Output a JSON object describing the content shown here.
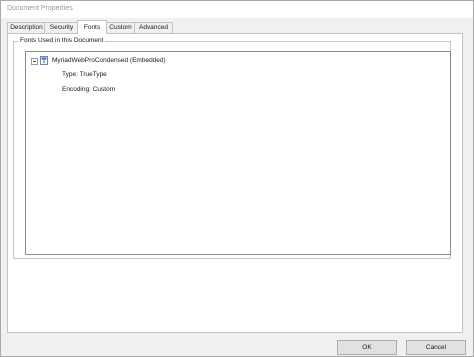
{
  "window": {
    "title": "Document Properties"
  },
  "tabs": [
    {
      "label": "Description"
    },
    {
      "label": "Security"
    },
    {
      "label": "Fonts",
      "active": true
    },
    {
      "label": "Custom"
    },
    {
      "label": "Advanced"
    }
  ],
  "fonts_group": {
    "label": "Fonts Used in this Document"
  },
  "font_tree": {
    "items": [
      {
        "name": "MyriadWebProCondensed (Embedded)",
        "icon": "truetype-font-icon",
        "expanded": true,
        "details": {
          "type": "Type: TrueType",
          "encoding": "Encoding: Custom"
        }
      }
    ]
  },
  "buttons": {
    "ok_label": "OK",
    "cancel_label": "Cancel"
  }
}
